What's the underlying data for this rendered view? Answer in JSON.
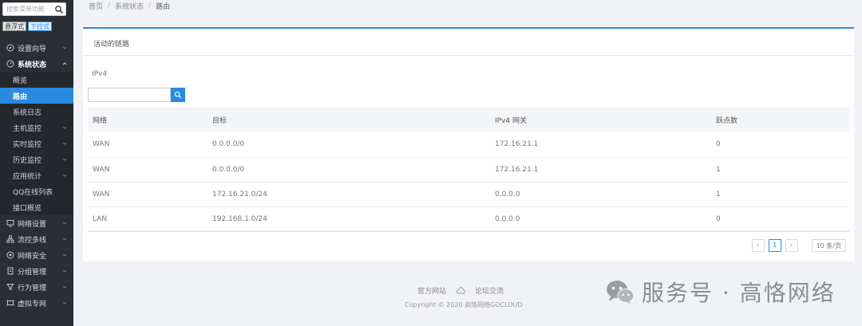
{
  "sidebar": {
    "search_placeholder": "搜索菜单功能",
    "mode_buttons": [
      {
        "label": "悬浮式",
        "active": false
      },
      {
        "label": "下拉式",
        "active": true
      }
    ],
    "items": [
      {
        "label": "设置向导",
        "icon": "compass-icon"
      },
      {
        "label": "系统状态",
        "icon": "gauge-icon"
      }
    ],
    "sub_items": [
      {
        "label": "概览"
      },
      {
        "label": "路由",
        "active": true
      },
      {
        "label": "系统日志"
      },
      {
        "label": "主机监控"
      },
      {
        "label": "实时监控"
      },
      {
        "label": "历史监控"
      },
      {
        "label": "应用统计"
      },
      {
        "label": "QQ在线列表"
      },
      {
        "label": "接口概览"
      }
    ],
    "lower_items": [
      {
        "label": "网络设置",
        "icon": "monitor-icon"
      },
      {
        "label": "流控多线",
        "icon": "network-icon"
      },
      {
        "label": "网络安全",
        "icon": "shield-icon"
      },
      {
        "label": "分组管理",
        "icon": "document-icon"
      },
      {
        "label": "行为管理",
        "icon": "filter-icon"
      },
      {
        "label": "虚拟专网",
        "icon": "vpn-icon"
      }
    ]
  },
  "breadcrumb": {
    "home": "首页",
    "section": "系统状态",
    "current": "路由",
    "separator": "/"
  },
  "panel": {
    "title": "活动的链路",
    "subtitle": "IPv4",
    "columns": [
      "网络",
      "目标",
      "IPv4 网关",
      "跃点数"
    ],
    "rows": [
      [
        "WAN",
        "0.0.0.0/0",
        "172.16.21.1",
        "0"
      ],
      [
        "WAN",
        "0.0.0.0/0",
        "172.16.21.1",
        "1"
      ],
      [
        "WAN",
        "172.16.21.0/24",
        "0.0.0.0",
        "1"
      ],
      [
        "LAN",
        "192.168.1.0/24",
        "0.0.0.0",
        "0"
      ]
    ],
    "pagination": {
      "prev": "‹",
      "page": "1",
      "next": "›",
      "page_size": "10 条/页"
    }
  },
  "footer": {
    "link1": "官方网站",
    "link2": "论坛交流",
    "copyright": "Copyright © 2020 高恪网络GOCLOUD"
  },
  "watermark": {
    "text": "服务号 · 高恪网络"
  },
  "colors": {
    "accent": "#2a8ae0",
    "sidebar_bg": "#2b2f35"
  }
}
